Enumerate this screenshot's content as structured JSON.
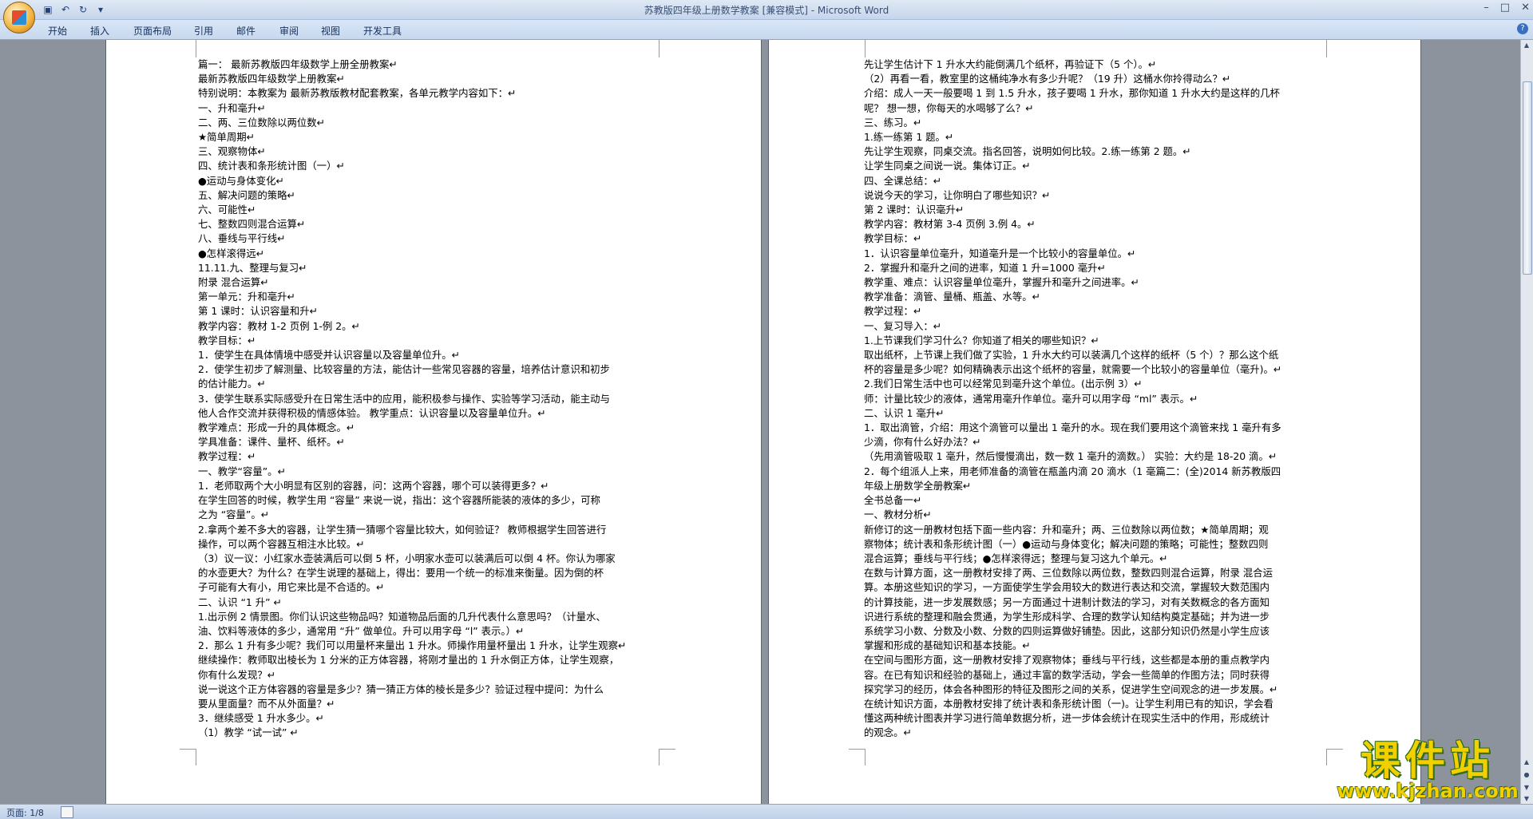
{
  "window": {
    "title": "苏教版四年级上册数学教案 [兼容模式] - Microsoft Word",
    "controls": [
      "minimize-icon",
      "maximize-icon",
      "close-icon"
    ]
  },
  "ribbon": {
    "tabs": [
      "开始",
      "插入",
      "页面布局",
      "引用",
      "邮件",
      "审阅",
      "视图",
      "开发工具"
    ]
  },
  "status": {
    "page": "页面: 1/8"
  },
  "watermark": {
    "title": "课件站",
    "url": "www.kjzhan.com"
  },
  "left_page": {
    "lines": [
      "   篇一：  最新苏教版四年级数学上册全册教案↵",
      " 最新苏教版四年级数学上册教案↵",
      " 特别说明：本教案为 最新苏教版教材配套教案，各单元教学内容如下：↵",
      " 一、升和毫升↵",
      "二、两、三位数除以两位数↵",
      "★简单周期↵",
      "三、观察物体↵",
      "四、统计表和条形统计图（一）↵",
      "●运动与身体变化↵",
      "五、解决问题的策略↵",
      "六、可能性↵",
      "七、整数四则混合运算↵",
      "八、垂线与平行线↵",
      "●怎样滚得远↵",
      "11.11.九、整理与复习↵",
      "附录 混合运算↵",
      "第一单元：升和毫升↵",
      "第 1 课时：认识容量和升↵",
      "教学内容：教材 1-2 页例 1-例 2。↵",
      "教学目标：↵",
      "1．使学生在具体情境中感受并认识容量以及容量单位升。↵",
      "2．使学生初步了解测量、比较容量的方法，能估计一些常见容器的容量，培养估计意识和初步",
      "的估计能力。↵",
      "3．使学生联系实际感受升在日常生活中的应用，能积极参与操作、实验等学习活动，能主动与",
      "他人合作交流并获得积极的情感体验。   教学重点：认识容量以及容量单位升。↵",
      "教学难点：形成一升的具体概念。↵",
      "学具准备：课件、量杯、纸杯。↵",
      "教学过程：↵",
      "一、教学“容量”。↵",
      "1．老师取两个大小明显有区别的容器，问：这两个容器，哪个可以装得更多？↵",
      "在学生回答的时候，教学生用 “容量” 来说一说，指出：这个容器所能装的液体的多少，可称",
      "之为 “容量”。↵",
      "2.拿两个差不多大的容器，让学生猜一猜哪个容量比较大，如何验证？ 教师根据学生回答进行",
      "操作，可以两个容器互相注水比较。↵",
      "（3）议一议：小红家水壶装满后可以倒 5 杯，小明家水壶可以装满后可以倒 4 杯。你认为哪家",
      "的水壶更大？为什么？在学生说理的基础上，得出：要用一个统一的标准来衡量。因为倒的杯",
      "子可能有大有小，用它来比是不合适的。↵",
      "二、认识 “1 升” ↵",
      "1.出示例 2 情景图。你们认识这些物品吗？知道物品后面的几升代表什么意思吗？（计量水、",
      "油、饮料等液体的多少，通常用 “升” 做单位。升可以用字母 “l” 表示。）↵",
      "2．那么 1 升有多少呢？我们可以用量杯来量出 1 升水。师操作用量杯量出 1 升水，让学生观察↵",
      "继续操作：教师取出棱长为 1 分米的正方体容器，将刚才量出的 1 升水倒正方体，让学生观察，",
      "你有什么发现？↵",
      "说一说这个正方体容器的容量是多少？猜一猜正方体的棱长是多少？验证过程中提问：为什么",
      "要从里面量？而不从外面量？↵",
      "3．继续感受 1 升水多少。↵",
      "（1）教学 “试一试” ↵"
    ]
  },
  "right_page": {
    "lines": [
      "先让学生估计下 1 升水大约能倒满几个纸杯，再验证下（5 个）。↵",
      "（2）再看一看，教室里的这桶纯净水有多少升呢？（19 升）这桶水你拎得动么？↵",
      "介绍：成人一天一般要喝 1 到 1.5 升水，孩子要喝 1 升水，那你知道 1 升水大约是这样的几杯",
      "呢？ 想一想，你每天的水喝够了么？↵",
      "三、练习。↵",
      "1.练一练第 1 题。↵",
      "先让学生观察，同桌交流。指名回答，说明如何比较。2.练一练第 2 题。↵",
      "让学生同桌之间说一说。集体订正。↵",
      "四、全课总结：↵",
      "说说今天的学习，让你明白了哪些知识？↵",
      "第 2 课时：认识毫升↵",
      "教学内容：教材第 3-4 页例 3.例 4。↵",
      "教学目标：↵",
      "1．认识容量单位毫升，知道毫升是一个比较小的容量单位。↵",
      "2．掌握升和毫升之间的进率，知道 1 升=1000 毫升↵",
      "教学重、难点：认识容量单位毫升，掌握升和毫升之间进率。↵",
      "教学准备：滴管、量桶、瓶盖、水等。↵",
      "教学过程：↵",
      "一、复习导入：↵",
      "1.上节课我们学习什么？你知道了相关的哪些知识？↵",
      "取出纸杯，上节课上我们做了实验，1 升水大约可以装满几个这样的纸杯（5 个）？那么这个纸",
      "杯的容量是多少呢？如何精确表示出这个纸杯的容量，就需要一个比较小的容量单位（毫升)。↵",
      "2.我们日常生活中也可以经常见到毫升这个单位。(出示例 3）↵",
      "师：计量比较少的液体，通常用毫升作单位。毫升可以用字母 “ml” 表示。↵",
      "二、认识 1 毫升↵",
      "1．取出滴管，介绍：用这个滴管可以量出 1 毫升的水。现在我们要用这个滴管来找 1 毫升有多",
      "少滴，你有什么好办法？↵",
      "（先用滴管吸取 1 毫升，然后慢慢滴出，数一数 1 毫升的滴数。）  实验：大约是 18-20 滴。↵",
      "2．每个组派人上来，用老师准备的滴管在瓶盖内滴 20 滴水（1 毫篇二：(全)2014 新苏教版四",
      "年级上册数学全册教案↵",
      "全书总备一↵",
      "一、教材分析↵",
      "新修订的这一册教材包括下面一些内容：升和毫升；两、三位数除以两位数；★简单周期；观",
      "察物体；统计表和条形统计图（一）●运动与身体变化；解决问题的策略；可能性；整数四则",
      "混合运算；垂线与平行线；●怎样滚得远；整理与复习这九个单元。↵",
      "在数与计算方面，这一册教材安排了两、三位数除以两位数，整数四则混合运算，附录 混合运",
      "算。本册这些知识的学习，一方面使学生学会用较大的数进行表达和交流，掌握较大数范围内",
      "的计算技能，进一步发展数感；另一方面通过十进制计数法的学习，对有关数概念的各方面知",
      "识进行系统的整理和融会贯通，为学生形成科学、合理的数学认知结构奠定基础；并为进一步",
      "系统学习小数、分数及小数、分数的四则运算做好铺垫。因此，这部分知识仍然是小学生应该",
      "掌握和形成的基础知识和基本技能。↵",
      "在空间与图形方面，这一册教材安排了观察物体；垂线与平行线，这些都是本册的重点教学内",
      "容。在已有知识和经验的基础上，通过丰富的数学活动，学会一些简单的作图方法；同时获得",
      "探究学习的经历，体会各种图形的特征及图形之间的关系，促进学生空间观念的进一步发展。↵",
      "在统计知识方面，本册教材安排了统计表和条形统计图（一)。让学生利用已有的知识，学会看",
      "懂这两种统计图表并学习进行简单数据分析，进一步体会统计在现实生活中的作用，形成统计",
      "的观念。↵"
    ]
  }
}
